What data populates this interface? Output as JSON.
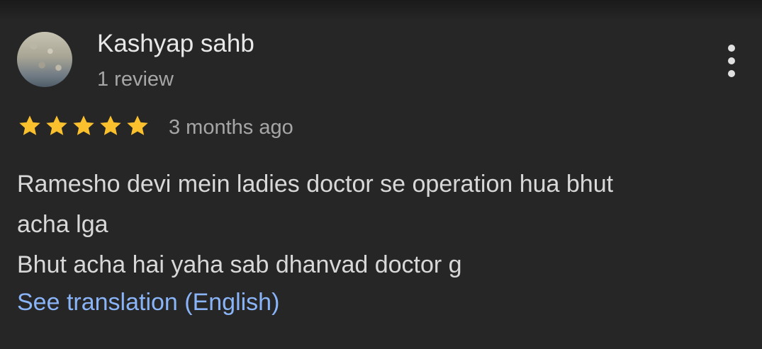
{
  "review": {
    "author_name": "Kashyap sahb",
    "review_count": "1 review",
    "rating": 5,
    "max_rating": 5,
    "timestamp": "3 months ago",
    "text_lines": [
      "Ramesho devi mein ladies doctor se operation hua bhut",
      "acha lga",
      "Bhut acha hai yaha sab dhanvad doctor g"
    ],
    "translate_link": "See translation (English)"
  },
  "icons": {
    "more": "more-vert-icon",
    "star": "star-icon"
  },
  "colors": {
    "background": "#262626",
    "star": "#fbc02d",
    "link": "#8ab4f8",
    "primary_text": "#e8e8e8",
    "secondary_text": "#a6a6a6"
  }
}
